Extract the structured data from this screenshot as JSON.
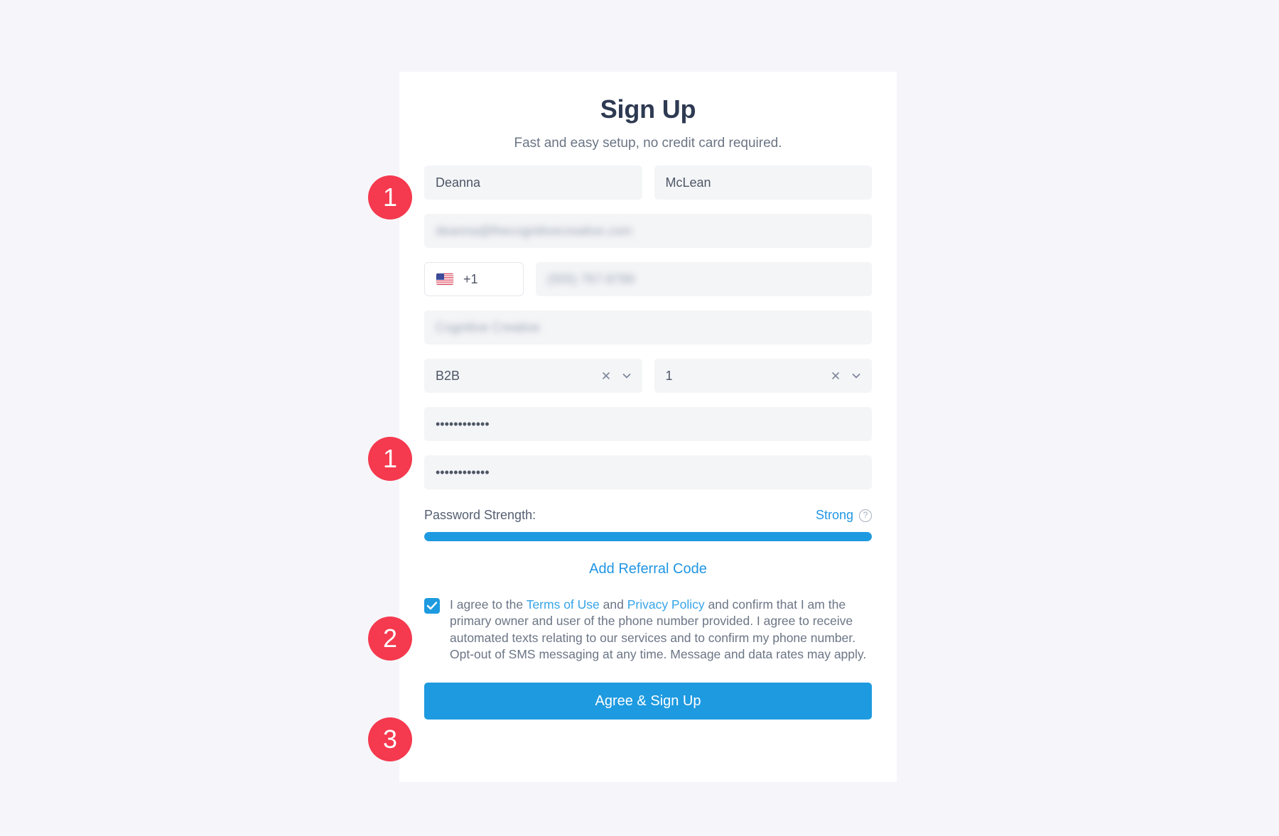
{
  "form": {
    "title": "Sign Up",
    "subtitle": "Fast and easy setup, no credit card required.",
    "first_name": "Deanna",
    "last_name": "McLean",
    "email": "deanna@thecognitivecreative.com",
    "country_code": "+1",
    "country_flag_icon": "us-flag-icon",
    "phone": "(555) 767-8789",
    "company": "Cognitive Creative",
    "business_type": "B2B",
    "employee_count": "1",
    "password": "••••••••••••",
    "password_confirm": "••••••••••••",
    "clear_icon": "x-icon",
    "chevron_icon": "chevron-down-icon"
  },
  "password_strength": {
    "label": "Password Strength:",
    "value": "Strong",
    "help_icon": "question-circle-icon",
    "percent": 100,
    "bar_color": "#1e9ae0"
  },
  "referral": {
    "label": "Add Referral Code"
  },
  "consent": {
    "checked": true,
    "part1": "I agree to the ",
    "terms_link": "Terms of Use",
    "part2": " and ",
    "privacy_link": "Privacy Policy",
    "part3": " and confirm that I am the primary owner and user of the phone number provided. I agree to receive automated texts relating to our services and to confirm my phone number. Opt-out of SMS messaging at any time. Message and data rates may apply."
  },
  "submit": {
    "label": "Agree & Sign Up"
  },
  "badges": {
    "step1a": "1",
    "step1b": "1",
    "step2": "2",
    "step3": "3"
  },
  "colors": {
    "accent_blue": "#1e9ae0",
    "link_blue": "#36a4e8",
    "badge_red": "#f5394e",
    "page_background": "#f6f6fa",
    "card_background": "#ffffff",
    "input_background": "#f4f5f7"
  }
}
